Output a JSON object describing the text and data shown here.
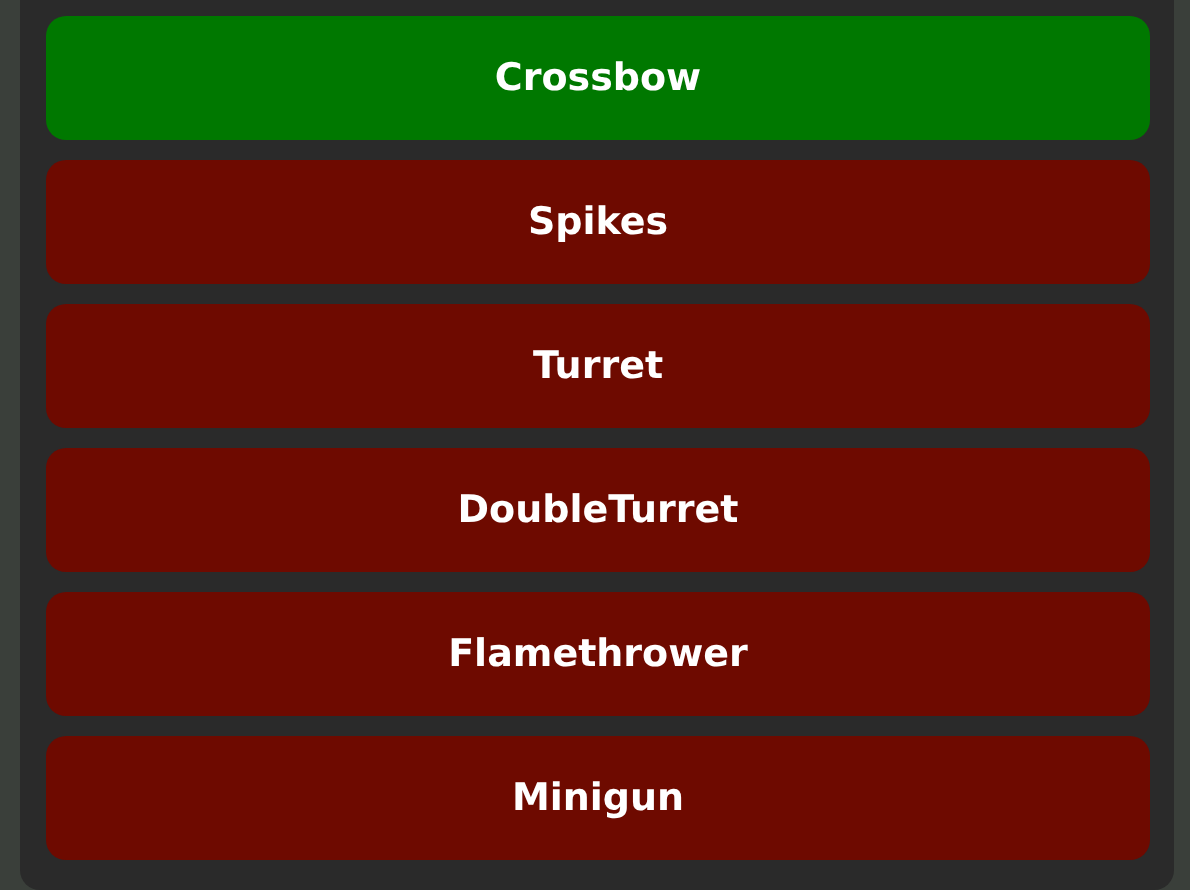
{
  "items": [
    {
      "label": "Crossbow",
      "selected": true
    },
    {
      "label": "Spikes",
      "selected": false
    },
    {
      "label": "Turret",
      "selected": false
    },
    {
      "label": "DoubleTurret",
      "selected": false
    },
    {
      "label": "Flamethrower",
      "selected": false
    },
    {
      "label": "Minigun",
      "selected": false
    }
  ]
}
